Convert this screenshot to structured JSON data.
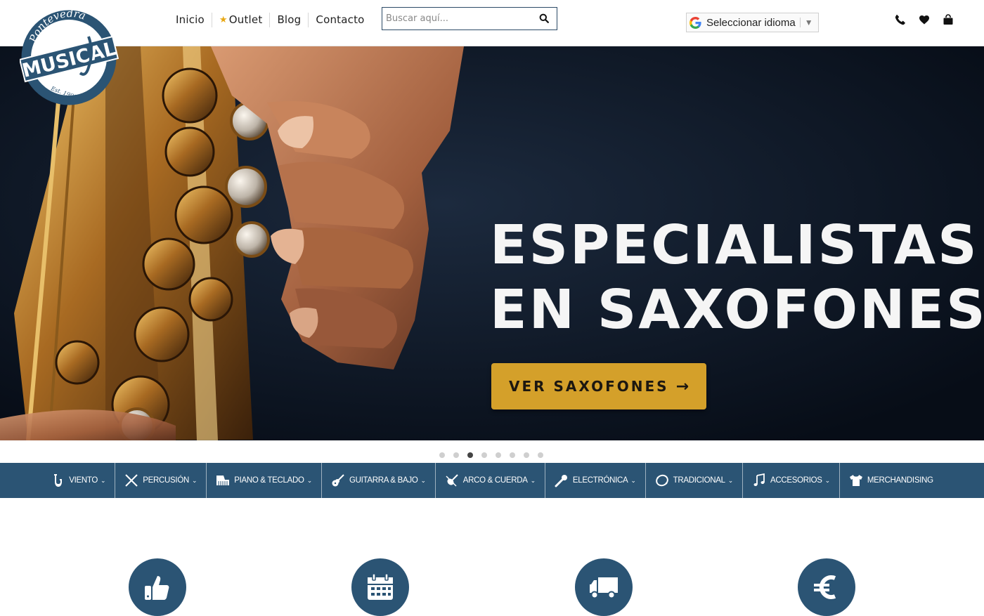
{
  "header": {
    "logo_text": "MUSICAL",
    "logo_subtext": "Pontevedra",
    "logo_est": "Est. 1998",
    "nav": [
      {
        "label": "Inicio"
      },
      {
        "label": "Outlet",
        "icon": "star-icon"
      },
      {
        "label": "Blog"
      },
      {
        "label": "Contacto"
      }
    ],
    "search": {
      "placeholder": "Buscar aquí..."
    },
    "language": {
      "label": "Seleccionar idioma"
    },
    "icons": [
      "phone-icon",
      "heart-icon",
      "cart-icon"
    ]
  },
  "hero": {
    "title_line1": "ESPECIALISTAS",
    "title_line2": "EN SAXOFONES",
    "button_label": "VER SAXOFONES",
    "button_arrow": "→",
    "slide_count": 8,
    "active_slide": 3
  },
  "categories": [
    {
      "label": "VIENTO",
      "icon": "saxophone-icon",
      "has_dropdown": true
    },
    {
      "label": "PERCUSIÓN",
      "icon": "drumsticks-icon",
      "has_dropdown": true
    },
    {
      "label": "PIANO & TECLADO",
      "icon": "piano-icon",
      "has_dropdown": true
    },
    {
      "label": "GUITARRA & BAJO",
      "icon": "guitar-icon",
      "has_dropdown": true
    },
    {
      "label": "ARCO & CUERDA",
      "icon": "violin-icon",
      "has_dropdown": true
    },
    {
      "label": "ELECTRÓNICA",
      "icon": "microphone-icon",
      "has_dropdown": true
    },
    {
      "label": "TRADICIONAL",
      "icon": "tambourine-icon",
      "has_dropdown": true
    },
    {
      "label": "ACCESORIOS",
      "icon": "music-notes-icon",
      "has_dropdown": true
    },
    {
      "label": "MERCHANDISING",
      "icon": "tshirt-icon",
      "has_dropdown": false
    }
  ],
  "features": [
    "thumbs-up-icon",
    "calendar-icon",
    "truck-icon",
    "euro-icon"
  ],
  "colors": {
    "primary": "#2b5474",
    "accent": "#d4a02a",
    "hero_bg": "#0b1422",
    "star": "#e8a712"
  }
}
